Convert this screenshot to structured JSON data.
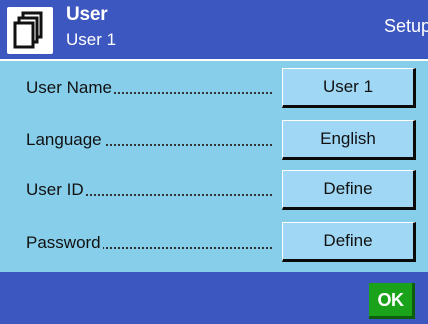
{
  "header": {
    "title": "User",
    "subtitle": "User 1",
    "mode": "Setup",
    "icon": "user-profile-stack-icon"
  },
  "settings": [
    {
      "label": "User Name",
      "value": "User 1"
    },
    {
      "label": "Language",
      "value": "English"
    },
    {
      "label": "User ID",
      "value": "Define"
    },
    {
      "label": "Password",
      "value": "Define"
    }
  ],
  "footer": {
    "ok_label": "OK"
  },
  "colors": {
    "header_bg": "#3d57c0",
    "content_bg": "#87ceeb",
    "button_bg": "#9fd7f4",
    "ok_bg": "#1aa31a"
  }
}
